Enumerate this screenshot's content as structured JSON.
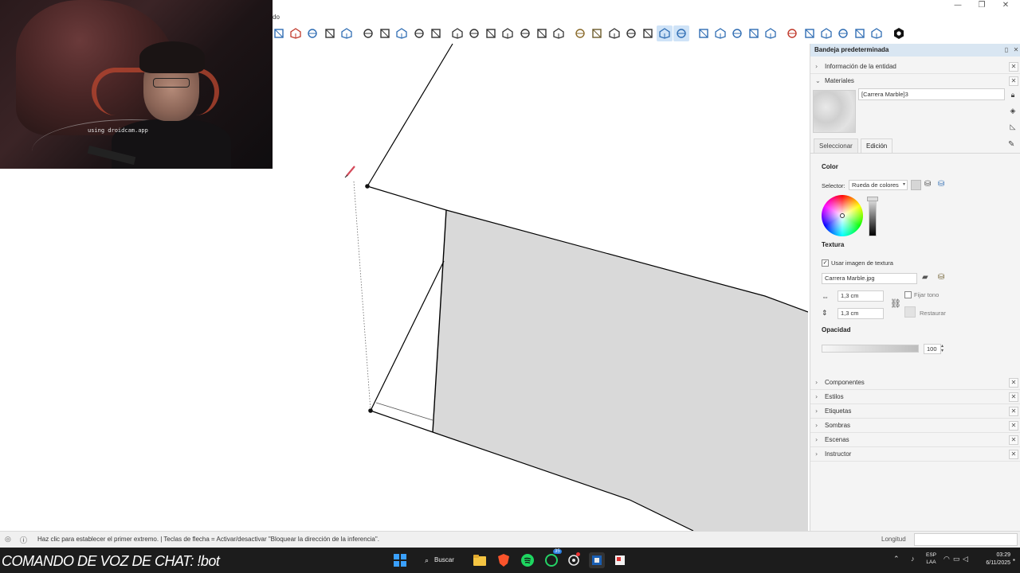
{
  "titlebar": {
    "menu_fragment": "do",
    "window_controls": [
      "minimize-icon",
      "maximize-icon",
      "close-icon"
    ],
    "control_glyphs": [
      "—",
      "❐",
      "✕"
    ]
  },
  "toolbar": {
    "icons": [
      "orbit-partial-icon",
      "section-plane-icon",
      "walk-icon",
      "zoom-icon",
      "zoom-extents-icon",
      "look-around-icon",
      "shadow-icon",
      "position-camera-icon",
      "layers-icon",
      "settings-circle-icon",
      "iso-view-icon",
      "top-view-icon",
      "front-view-icon",
      "right-view-icon",
      "back-view-icon",
      "left-view-icon",
      "bottom-view-icon",
      "xray-icon",
      "back-edges-icon",
      "wireframe-icon",
      "hidden-line-icon",
      "shaded-icon",
      "textured-icon",
      "monochrome-icon",
      "sandbox-from-contours-icon",
      "sandbox-from-scratch-icon",
      "sandbox-smoove-icon",
      "sandbox-stamp-icon",
      "sandbox-drape-icon",
      "solid-outer-shell-icon",
      "solid-intersect-icon",
      "solid-union-icon",
      "solid-subtract-icon",
      "solid-trim-icon",
      "solid-split-icon",
      "extension-logo-icon"
    ]
  },
  "webcam": {
    "watermark": "using droidcam.app"
  },
  "panel": {
    "title": "Bandeja predeterminada",
    "sections_top": [
      {
        "label": "Información de la entidad",
        "expanded": false
      },
      {
        "label": "Materiales",
        "expanded": true
      }
    ],
    "material_name": "[Carrera Marble]3",
    "tabs": [
      {
        "label": "Seleccionar",
        "selected": false
      },
      {
        "label": "Edición",
        "selected": true
      }
    ],
    "color": {
      "heading": "Color",
      "selector_label": "Selector:",
      "selector_value": "Rueda de colores"
    },
    "texture": {
      "heading": "Textura",
      "use_image_label": "Usar imagen de textura",
      "use_image_checked": true,
      "filename": "Carrera Marble.jpg",
      "width": "1,3 cm",
      "height": "1,3 cm",
      "fix_tone_label": "Fijar tono",
      "fix_tone_checked": false,
      "reset_label": "Restaurar"
    },
    "opacity": {
      "heading": "Opacidad",
      "value": "100"
    },
    "sections_bottom": [
      {
        "label": "Componentes"
      },
      {
        "label": "Estilos"
      },
      {
        "label": "Etiquetas"
      },
      {
        "label": "Sombras"
      },
      {
        "label": "Escenas"
      },
      {
        "label": "Instructor"
      }
    ]
  },
  "statusbar": {
    "text": "Haz clic para establecer el primer extremo. | Teclas de flecha = Activar/desactivar \"Bloquear la dirección de la inferencia\".",
    "measure_label": "Longitud",
    "measure_value": ""
  },
  "overlay": {
    "text": "COMANDO DE VOZ DE CHAT: !bot"
  },
  "taskbar": {
    "search_label": "Buscar",
    "apps": [
      "windows-start-icon",
      "search-icon",
      "file-explorer-icon",
      "brave-browser-icon",
      "spotify-icon",
      "whatsapp-icon",
      "chatgpt-icon",
      "sketchup-icon",
      "layout-icon"
    ],
    "whatsapp_badge": "35",
    "tray_lang_1": "ESP",
    "tray_lang_2": "LAA",
    "time": "03:29",
    "date": "6/11/2025"
  },
  "colors": {
    "panel_header": "#d9e6f2",
    "face_fill": "#d9d9d9",
    "taskbar": "#1c1c1c",
    "active_tool": "#cfe3f7"
  }
}
